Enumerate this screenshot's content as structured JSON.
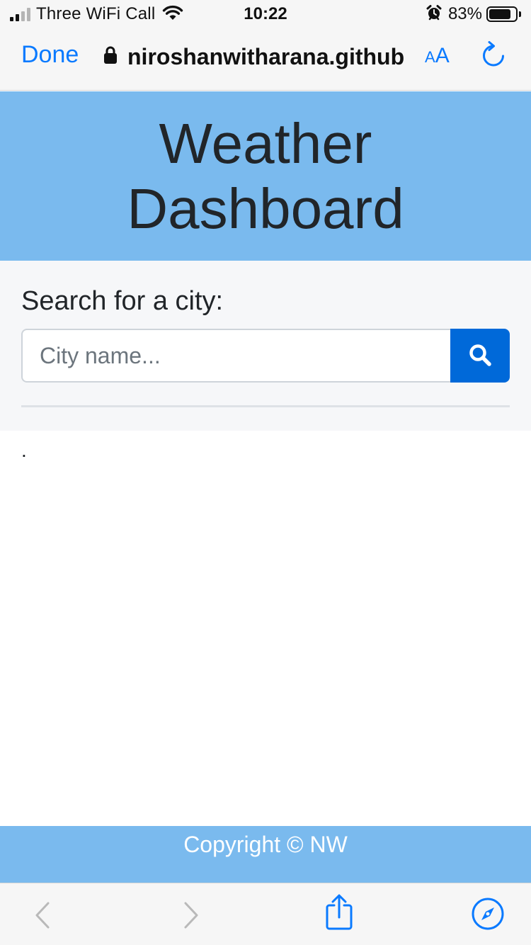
{
  "status_bar": {
    "carrier": "Three WiFi Call",
    "time": "10:22",
    "battery_percent": "83%",
    "battery_level": 0.83,
    "signal_bars": 2,
    "icons": [
      "signal-icon",
      "wifi-icon",
      "alarm-icon",
      "battery-icon"
    ]
  },
  "browser": {
    "done_label": "Done",
    "url": "niroshanwitharana.github",
    "aa_label_small": "A",
    "aa_label_large": "A",
    "accent_color": "#0a7aff",
    "icons": [
      "lock-icon",
      "reload-icon",
      "back-icon",
      "forward-icon",
      "share-icon",
      "compass-icon"
    ]
  },
  "header": {
    "title": "Weather Dashboard",
    "background": "#7abaee"
  },
  "search": {
    "label": "Search for a city:",
    "placeholder": "City name...",
    "value": "",
    "button_color": "#0069d9",
    "button_icon": "search-icon"
  },
  "results": {
    "text": "."
  },
  "footer": {
    "text": "Copyright © NW"
  }
}
